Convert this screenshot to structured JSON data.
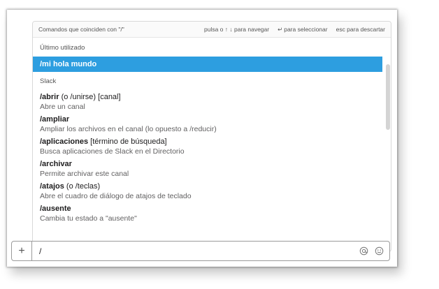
{
  "header": {
    "matching_text": "Comandos que coinciden con \"/\"",
    "hint_navigate": "pulsa o ↑ ↓ para navegar",
    "hint_select": "para seleccionar",
    "hint_select_icon": "↵",
    "hint_cancel": "esc para descartar"
  },
  "sections": {
    "recent": "Último utilizado",
    "slack": "Slack"
  },
  "recent_item": {
    "command": "/mi hola mundo"
  },
  "commands": [
    {
      "name": "/abrir",
      "args": " (o /unirse) [canal]",
      "desc": "Abre un canal"
    },
    {
      "name": "/ampliar",
      "args": "",
      "desc": "Ampliar los archivos en el canal (lo opuesto a /reducir)"
    },
    {
      "name": "/aplicaciones",
      "args": " [término de búsqueda]",
      "desc": "Busca aplicaciones de Slack en el Directorio"
    },
    {
      "name": "/archivar",
      "args": "",
      "desc": "Permite archivar este canal"
    },
    {
      "name": "/atajos",
      "args": " (o /teclas)",
      "desc": "Abre el cuadro de diálogo de atajos de teclado"
    },
    {
      "name": "/ausente",
      "args": "",
      "desc": "Cambia tu estado a \"ausente\""
    }
  ],
  "input": {
    "value": "/",
    "plus_label": "+"
  },
  "icons": {
    "plus": "plus-icon",
    "mention": "at-icon",
    "emoji": "emoji-icon"
  },
  "colors": {
    "selected": "#2d9ee0"
  }
}
